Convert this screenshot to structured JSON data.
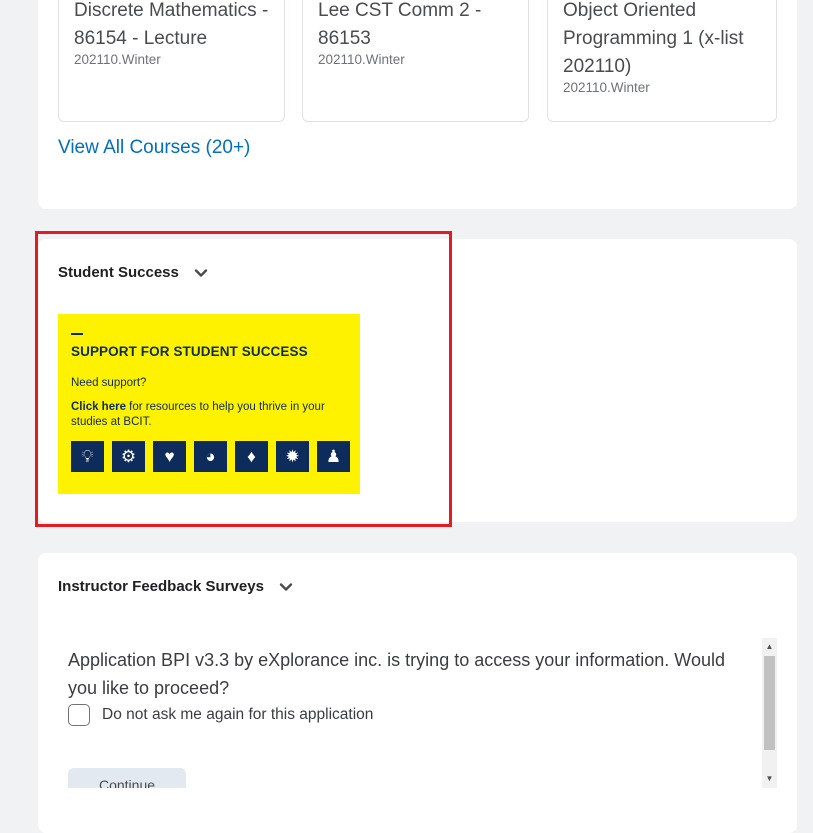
{
  "courses": {
    "tiles": [
      {
        "title": "Discrete Mathematics - 86154 - Lecture",
        "term": "202110.Winter"
      },
      {
        "title": "Lee CST Comm 2 - 86153",
        "term": "202110.Winter"
      },
      {
        "title": "Object Oriented Programming 1 (x-list 202110)",
        "term": "202110.Winter"
      }
    ],
    "view_all": "View All Courses (20+)"
  },
  "student_success": {
    "title": "Student Success",
    "banner": {
      "heading": "SUPPORT FOR STUDENT SUCCESS",
      "need_support": "Need support?",
      "click_here": "Click here",
      "click_rest": " for resources to help you thrive in your studies at BCIT."
    }
  },
  "surveys": {
    "title": "Instructor Feedback Surveys",
    "message": "Application BPI v3.3 by eXplorance inc. is trying to access your information. Would you like to proceed?",
    "checkbox_label": "Do not ask me again for this application",
    "continue_label": "Continue"
  },
  "colors": {
    "link": "#006fbf",
    "highlight": "#e31b23",
    "banner_bg": "#fff200",
    "banner_ink": "#0d2c5c"
  }
}
